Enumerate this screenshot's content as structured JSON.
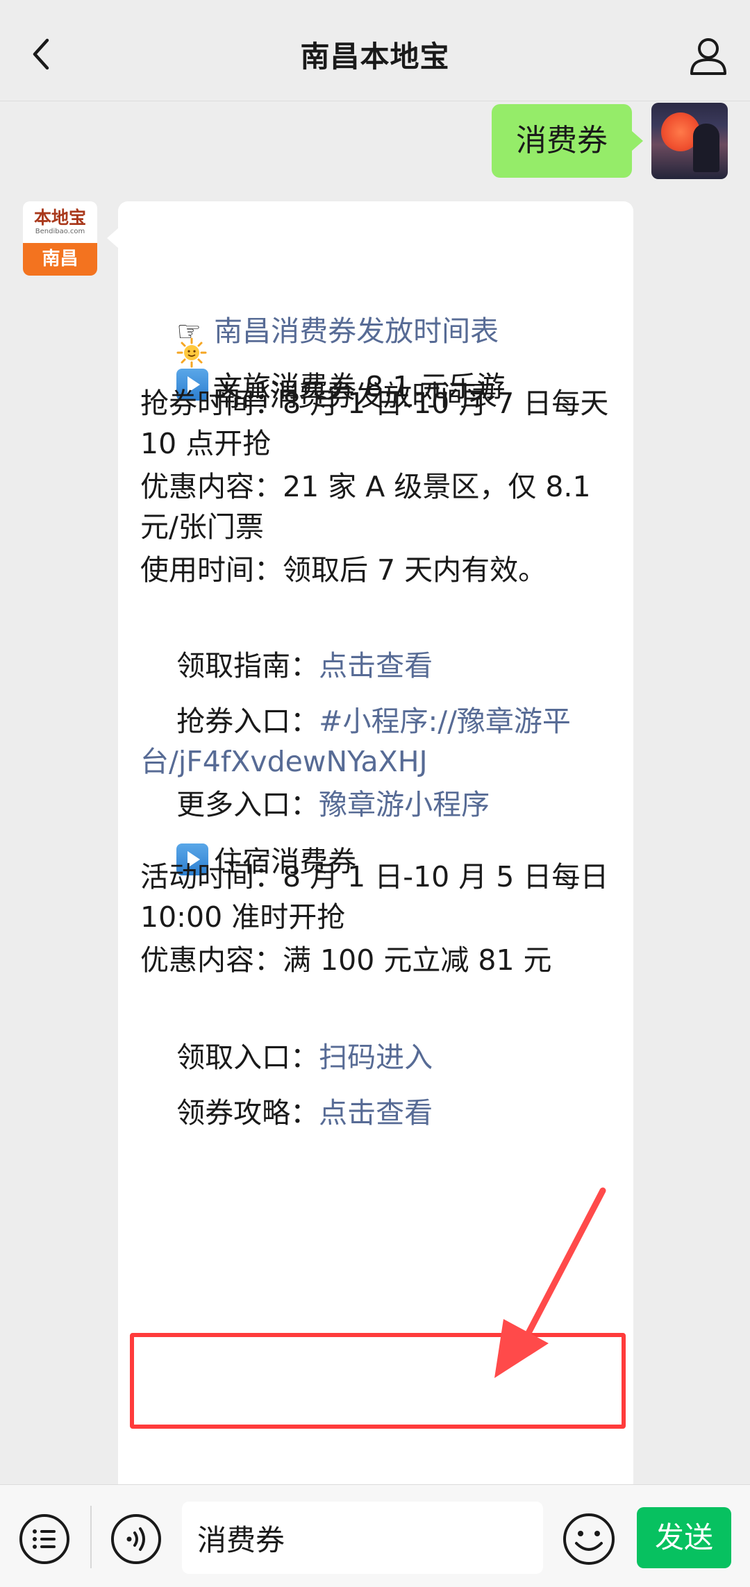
{
  "header": {
    "title": "南昌本地宝"
  },
  "sent_message": {
    "text": "消费券"
  },
  "bot": {
    "logo_text": "本地宝",
    "logo_sub": "Bendibao.com",
    "city": "南昌"
  },
  "message": {
    "title": "南昌消费券发放时间表",
    "title_link": "南昌消费券发放时间表",
    "section1_title": "文旅消费券 8.1 元乐游",
    "grab_time": "抢券时间：8 月 1 日-10 月 7 日每天10 点开抢",
    "discount1": "优惠内容：21 家 A 级景区，仅 8.1 元/张门票",
    "use_time": "使用时间：领取后 7 天内有效。",
    "guide_label": "领取指南：",
    "guide_link": "点击查看",
    "entry_label": "抢券入口：",
    "entry_link": "#小程序://豫章游平台/jF4fXvdewNYaXHJ",
    "more_label": "更多入口：",
    "more_link": "豫章游小程序",
    "section2_title": "住宿消费券",
    "activity_time": "活动时间：8 月 1 日-10 月 5 日每日10:00 准时开抢",
    "discount2": "优惠内容：满 100 元立减 81 元",
    "claim_label": "领取入口：",
    "claim_link": "扫码进入",
    "strategy_label": "领券攻略：",
    "strategy_link": "点击查看"
  },
  "input_bar": {
    "text": "消费券",
    "send_label": "发送"
  },
  "colors": {
    "link": "#576b95",
    "send": "#07c160",
    "sent_bubble": "#95ec69",
    "highlight": "#ff3b3b"
  }
}
